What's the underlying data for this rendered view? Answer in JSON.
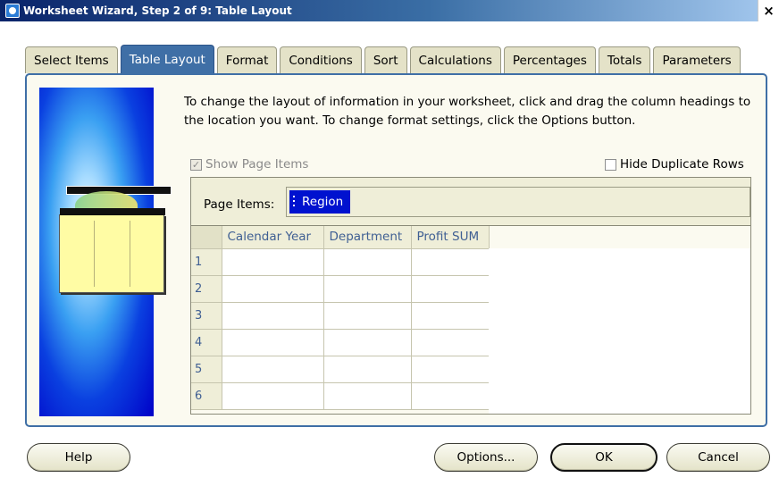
{
  "window": {
    "title": "Worksheet Wizard, Step 2 of 9: Table Layout",
    "close_glyph": "×"
  },
  "tabs": [
    {
      "label": "Select Items"
    },
    {
      "label": "Table Layout",
      "active": true
    },
    {
      "label": "Format"
    },
    {
      "label": "Conditions"
    },
    {
      "label": "Sort"
    },
    {
      "label": "Calculations"
    },
    {
      "label": "Percentages"
    },
    {
      "label": "Totals"
    },
    {
      "label": "Parameters"
    }
  ],
  "main": {
    "instructions": "To change the layout of information in your worksheet, click and drag the column headings to the location you want.  To change format settings, click the Options button.",
    "show_page_items": {
      "label": "Show Page Items",
      "checked": true,
      "disabled": true
    },
    "hide_duplicate_rows": {
      "label": "Hide Duplicate Rows",
      "checked": false
    },
    "page_items": {
      "label": "Page Items:",
      "item": "Region"
    },
    "grid": {
      "columns": [
        "Calendar Year",
        "Department",
        "Profit SUM"
      ],
      "rows": [
        "1",
        "2",
        "3",
        "4",
        "5",
        "6"
      ]
    }
  },
  "buttons": {
    "help": "Help",
    "options": "Options...",
    "ok": "OK",
    "cancel": "Cancel"
  },
  "colors": {
    "accent": "#3f6fa6",
    "panel_bg": "#fbfaf0",
    "tab_bg": "#e4e2c8",
    "chip_bg": "#0012cf"
  },
  "icons": {
    "app": "oracle-discoverer-icon",
    "close": "close-icon",
    "wizard_art": "worksheet-wizard-illustration"
  }
}
